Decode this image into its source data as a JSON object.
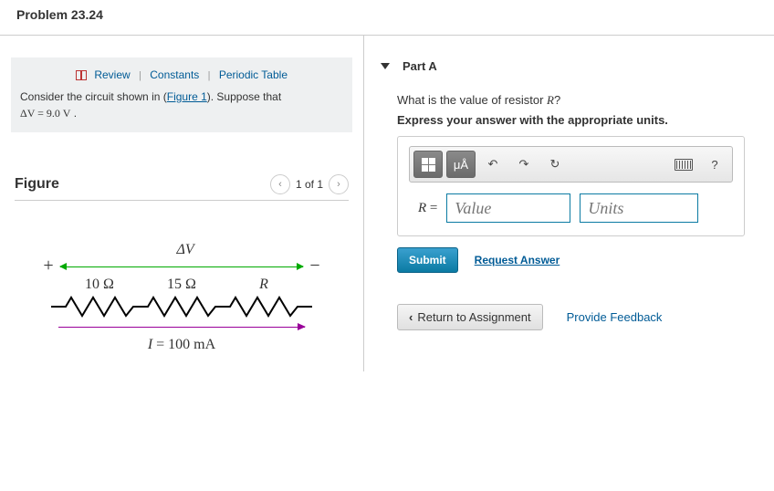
{
  "header": {
    "title": "Problem 23.24"
  },
  "review": {
    "links": {
      "review": "Review",
      "constants": "Constants",
      "periodic": "Periodic Table"
    },
    "prompt_pre": "Consider the circuit shown in (",
    "prompt_link": "Figure 1",
    "prompt_post": "). Suppose that ",
    "dv_expr": "ΔV = 9.0  V",
    "period": " ."
  },
  "figure": {
    "heading": "Figure",
    "pager": "1 of 1",
    "dv_label": "ΔV",
    "plus": "+",
    "minus": "−",
    "r1": "10 Ω",
    "r2": "15 Ω",
    "r3": "R",
    "i_label_i": "I",
    "i_label_eq": " = 100 mA"
  },
  "part": {
    "label": "Part A",
    "question_pre": "What is the value of resistor ",
    "question_var": "R",
    "question_post": "?",
    "instruction": "Express your answer with the appropriate units.",
    "eq_var": "R",
    "eq_sign": " = ",
    "value_ph": "Value",
    "units_ph": "Units",
    "submit": "Submit",
    "request": "Request Answer",
    "mu": "μÅ",
    "help": "?"
  },
  "bottom": {
    "return": "Return to Assignment",
    "feedback": "Provide Feedback"
  }
}
